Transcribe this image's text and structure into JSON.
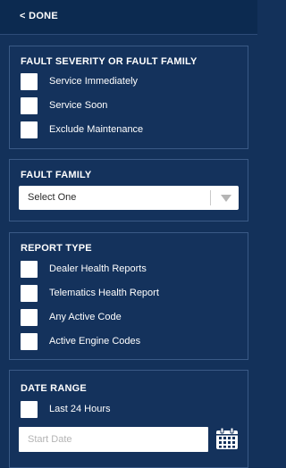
{
  "header": {
    "done_label": "< DONE"
  },
  "fault_severity": {
    "title": "FAULT SEVERITY OR FAULT FAMILY",
    "options": [
      "Service Immediately",
      "Service Soon",
      "Exclude Maintenance"
    ]
  },
  "fault_family": {
    "title": "FAULT FAMILY",
    "select_value": "Select One"
  },
  "report_type": {
    "title": "REPORT TYPE",
    "options": [
      "Dealer Health Reports",
      "Telematics Health Report",
      "Any Active Code",
      "Active Engine Codes"
    ]
  },
  "date_range": {
    "title": "DATE RANGE",
    "options": [
      "Last 24 Hours"
    ],
    "start_date_placeholder": "Start Date"
  },
  "icons": {
    "calendar": "calendar-icon",
    "dropdown": "chevron-down-icon"
  },
  "colors": {
    "background": "#13315a",
    "card_border": "#3a5a86",
    "text": "#ffffff"
  }
}
